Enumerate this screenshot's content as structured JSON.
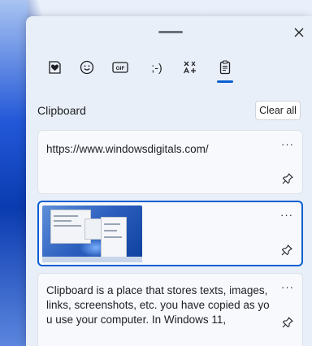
{
  "header": {
    "close_icon": "close-icon"
  },
  "tabs": [
    {
      "name": "stickers",
      "icon": "heart-sticker-icon"
    },
    {
      "name": "emoji",
      "icon": "smiley-icon"
    },
    {
      "name": "gif",
      "icon": "gif-icon",
      "label": "GIF"
    },
    {
      "name": "kaomoji",
      "icon": "kaomoji-icon",
      "label": ";-)"
    },
    {
      "name": "symbols",
      "icon": "symbols-icon"
    },
    {
      "name": "clipboard",
      "icon": "clipboard-icon",
      "active": true
    }
  ],
  "clipboard": {
    "title": "Clipboard",
    "clear_all_label": "Clear all",
    "items": [
      {
        "type": "text",
        "text": "https://www.windowsdigitals.com/"
      },
      {
        "type": "image",
        "selected": true,
        "alt": "screenshot thumbnail"
      },
      {
        "type": "text",
        "text": "Clipboard is a place that stores texts, images, links, screenshots, etc. you have copied as you use your computer. In Windows 11,"
      }
    ],
    "more_label": "···"
  },
  "colors": {
    "panel_bg": "#e9eff8",
    "card_bg": "#f7f9fc",
    "accent": "#0a5fd0",
    "text": "#1d1f22"
  }
}
